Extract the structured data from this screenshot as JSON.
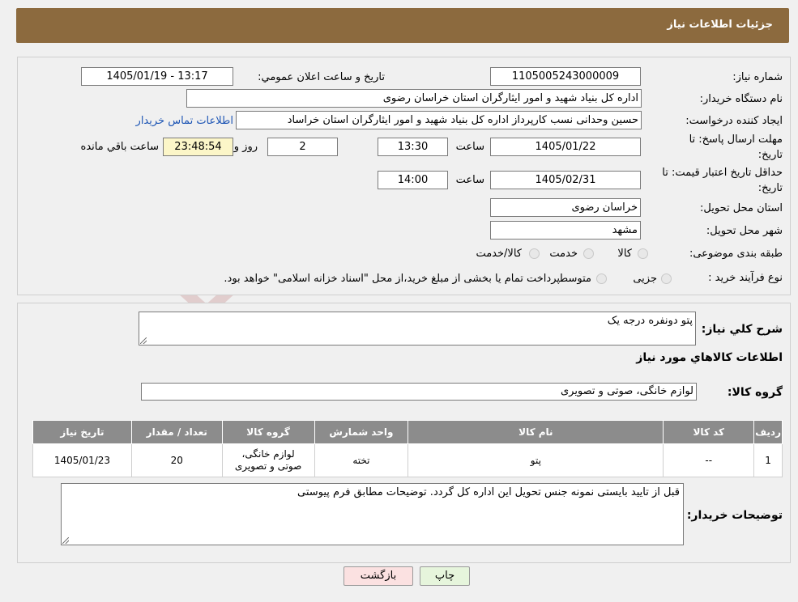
{
  "header": {
    "title": "جزئیات اطلاعات نیاز"
  },
  "fields": {
    "need_number_label": "شماره نیاز:",
    "need_number": "1105005243000009",
    "announce_label": "تاریخ و ساعت اعلان عمومي:",
    "announce_value": "1405/01/19 - 13:17",
    "buyer_org_label": "نام دستگاه خريدار:",
    "buyer_org": "اداره کل بنیاد شهید و امور ایثارگران استان خراسان رضوی",
    "creator_label": "ایجاد کننده درخواست:",
    "creator": "حسین وحدانی نسب کارپرداز اداره کل بنیاد شهید و امور ایثارگران استان خراساد",
    "contact_link": "اطلاعات تماس خریدار",
    "reply_deadline_label_1": "مهلت ارسال پاسخ: تا",
    "reply_deadline_label_2": "تاريخ:",
    "reply_date": "1405/01/22",
    "time_word": "ساعت",
    "reply_time": "13:30",
    "days_count": "2",
    "days_word": "روز و",
    "remaining_time": "23:48:54",
    "remaining_word": "ساعت باقي مانده",
    "validity_label_1": "حداقل تاريخ اعتبار قيمت: تا",
    "validity_label_2": "تاريخ:",
    "validity_date": "1405/02/31",
    "validity_time": "14:00",
    "province_label": "استان محل تحويل:",
    "province": "خراسان رضوی",
    "city_label": "شهر محل تحويل:",
    "city": "مشهد",
    "category_label": "طبقه بندی موضوعی:",
    "category_options": [
      "کالا",
      "خدمت",
      "کالا/خدمت"
    ],
    "process_label": "نوع فرآيند خريد :",
    "process_options": [
      "جزیی",
      "متوسط"
    ],
    "process_note": "پرداخت تمام یا بخشی از مبلغ خرید،از محل \"اسناد خزانه اسلامی\" خواهد بود."
  },
  "summary": {
    "title_label": "شرح کلي نياز:",
    "title_value": "پتو دونفره درجه یک",
    "items_header": "اطلاعات کالاهاي مورد نياز",
    "group_label": "گروه کالا:",
    "group_value": "لوازم خانگی، صوتی و تصویری"
  },
  "table": {
    "headers": [
      "رديف",
      "کد کالا",
      "نام کالا",
      "واحد شمارش",
      "گروه کالا",
      "تعداد / مقدار",
      "تاريخ نياز"
    ],
    "rows": [
      [
        "1",
        "--",
        "پتو",
        "تخته",
        "لوازم خانگی، صوتی و تصویری",
        "20",
        "1405/01/23"
      ]
    ]
  },
  "notes": {
    "label": "توضيحات خريدار:",
    "value": "قبل از تایید بایستی نمونه جنس تحویل این اداره کل گردد. توضیحات مطابق فرم پیوستی"
  },
  "buttons": {
    "print": "چاپ",
    "back": "بازگشت"
  },
  "colors": {
    "header_bg": "#8c6a3e",
    "link": "#1e56b5",
    "print_btn": "#e6f5dc",
    "back_btn": "#fbe1e1"
  }
}
